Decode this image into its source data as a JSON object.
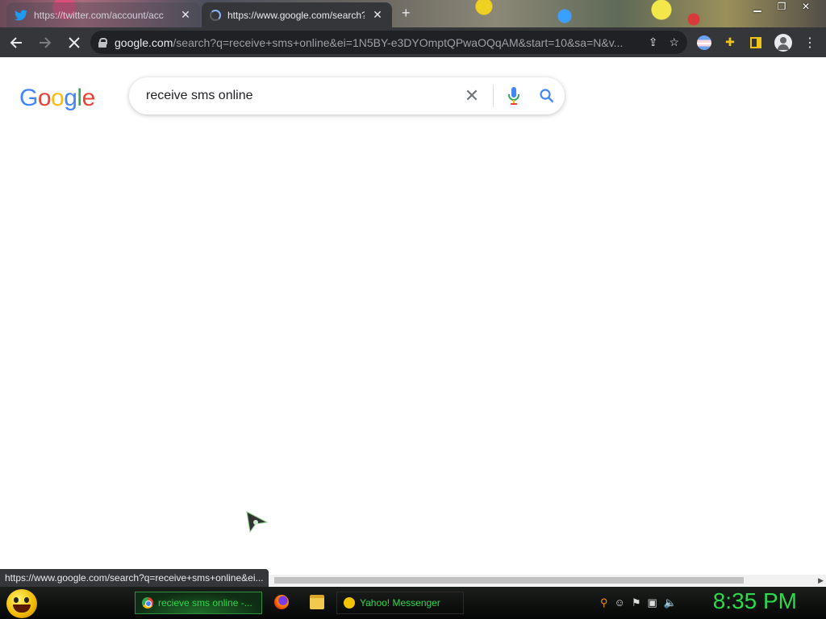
{
  "browser": {
    "tabs": [
      {
        "title": "https://twitter.com/account/acc",
        "active": false
      },
      {
        "title": "https://www.google.com/search?",
        "active": true
      }
    ],
    "new_tab": "+",
    "address": {
      "host": "google.com",
      "path": "/search?q=receive+sms+online&ei=1N5BY-e3DYOmptQPwaOQqAM&start=10&sa=N&v..."
    }
  },
  "google": {
    "logo_letters": [
      "G",
      "o",
      "o",
      "g",
      "l",
      "e"
    ],
    "query": "receive sms online"
  },
  "status_url": "https://www.google.com/search?q=receive+sms+online&ei...",
  "taskbar": {
    "tasks": [
      {
        "label": "recieve sms online -...",
        "icon": "chrome-icon"
      },
      {
        "label": "Yahoo! Messenger",
        "icon": "yahoo-messenger-icon"
      }
    ],
    "clock": "8:35 PM"
  },
  "colors": {
    "chrome_dark": "#35363a",
    "taskbar_text": "#2bd94a",
    "google_blue": "#4285f4"
  }
}
